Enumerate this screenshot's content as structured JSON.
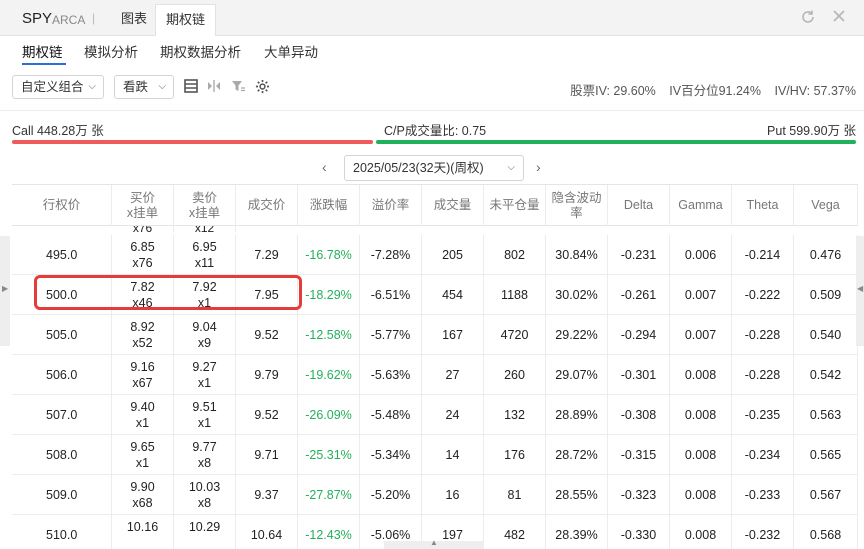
{
  "titlebar": {
    "symbol": "SPY",
    "exchange": "ARCA",
    "separator": "|",
    "tabs": [
      "图表",
      "期权链"
    ],
    "active_tab": "期权链"
  },
  "subtabs": [
    "期权链",
    "模拟分析",
    "期权数据分析",
    "大单异动"
  ],
  "toolbar": {
    "combo_select": "自定义组合",
    "direction_select": "看跌",
    "iv_label": "股票IV: 29.60%",
    "iv_percentile": "IV百分位91.24%",
    "iv_hv": "IV/HV: 57.37%"
  },
  "cp": {
    "call": "Call 448.28万 张",
    "ratio": "C/P成交量比: 0.75",
    "put": "Put 599.90万 张",
    "call_fraction": 0.4277
  },
  "expiry": {
    "label": "2025/05/23(32天)(周权)",
    "prev": "‹",
    "next": "›"
  },
  "columns": [
    {
      "key": "strike",
      "label": "行权价"
    },
    {
      "key": "bid",
      "label": "买价\nx挂单"
    },
    {
      "key": "ask",
      "label": "卖价\nx挂单"
    },
    {
      "key": "last",
      "label": "成交价"
    },
    {
      "key": "chg",
      "label": "涨跌幅"
    },
    {
      "key": "premium",
      "label": "溢价率"
    },
    {
      "key": "volume",
      "label": "成交量"
    },
    {
      "key": "oi",
      "label": "未平仓量"
    },
    {
      "key": "iv",
      "label": "隐含波动率"
    },
    {
      "key": "delta",
      "label": "Delta"
    },
    {
      "key": "gamma",
      "label": "Gamma"
    },
    {
      "key": "theta",
      "label": "Theta"
    },
    {
      "key": "vega",
      "label": "Vega"
    }
  ],
  "partial_row": {
    "bid": "x76",
    "ask": "x12"
  },
  "rows": [
    {
      "strike": "495.0",
      "bid": "6.85",
      "bid_size": "x76",
      "ask": "6.95",
      "ask_size": "x11",
      "last": "7.29",
      "chg": "-16.78%",
      "premium": "-7.28%",
      "volume": "205",
      "oi": "802",
      "iv": "30.84%",
      "delta": "-0.231",
      "gamma": "0.006",
      "theta": "-0.214",
      "vega": "0.476"
    },
    {
      "strike": "500.0",
      "bid": "7.82",
      "bid_size": "x46",
      "ask": "7.92",
      "ask_size": "x1",
      "last": "7.95",
      "chg": "-18.29%",
      "premium": "-6.51%",
      "volume": "454",
      "oi": "1188",
      "iv": "30.02%",
      "delta": "-0.261",
      "gamma": "0.007",
      "theta": "-0.222",
      "vega": "0.509"
    },
    {
      "strike": "505.0",
      "bid": "8.92",
      "bid_size": "x52",
      "ask": "9.04",
      "ask_size": "x9",
      "last": "9.52",
      "chg": "-12.58%",
      "premium": "-5.77%",
      "volume": "167",
      "oi": "4720",
      "iv": "29.22%",
      "delta": "-0.294",
      "gamma": "0.007",
      "theta": "-0.228",
      "vega": "0.540"
    },
    {
      "strike": "506.0",
      "bid": "9.16",
      "bid_size": "x67",
      "ask": "9.27",
      "ask_size": "x1",
      "last": "9.79",
      "chg": "-19.62%",
      "premium": "-5.63%",
      "volume": "27",
      "oi": "260",
      "iv": "29.07%",
      "delta": "-0.301",
      "gamma": "0.008",
      "theta": "-0.228",
      "vega": "0.542"
    },
    {
      "strike": "507.0",
      "bid": "9.40",
      "bid_size": "x1",
      "ask": "9.51",
      "ask_size": "x1",
      "last": "9.52",
      "chg": "-26.09%",
      "premium": "-5.48%",
      "volume": "24",
      "oi": "132",
      "iv": "28.89%",
      "delta": "-0.308",
      "gamma": "0.008",
      "theta": "-0.235",
      "vega": "0.563"
    },
    {
      "strike": "508.0",
      "bid": "9.65",
      "bid_size": "x1",
      "ask": "9.77",
      "ask_size": "x8",
      "last": "9.71",
      "chg": "-25.31%",
      "premium": "-5.34%",
      "volume": "14",
      "oi": "176",
      "iv": "28.72%",
      "delta": "-0.315",
      "gamma": "0.008",
      "theta": "-0.234",
      "vega": "0.565"
    },
    {
      "strike": "509.0",
      "bid": "9.90",
      "bid_size": "x68",
      "ask": "10.03",
      "ask_size": "x8",
      "last": "9.37",
      "chg": "-27.87%",
      "premium": "-5.20%",
      "volume": "16",
      "oi": "81",
      "iv": "28.55%",
      "delta": "-0.323",
      "gamma": "0.008",
      "theta": "-0.233",
      "vega": "0.567"
    },
    {
      "strike": "510.0",
      "bid": "10.16",
      "bid_size": "",
      "ask": "10.29",
      "ask_size": "",
      "last": "10.64",
      "chg": "-12.43%",
      "premium": "-5.06%",
      "volume": "197",
      "oi": "482",
      "iv": "28.39%",
      "delta": "-0.330",
      "gamma": "0.008",
      "theta": "-0.232",
      "vega": "0.568"
    }
  ]
}
